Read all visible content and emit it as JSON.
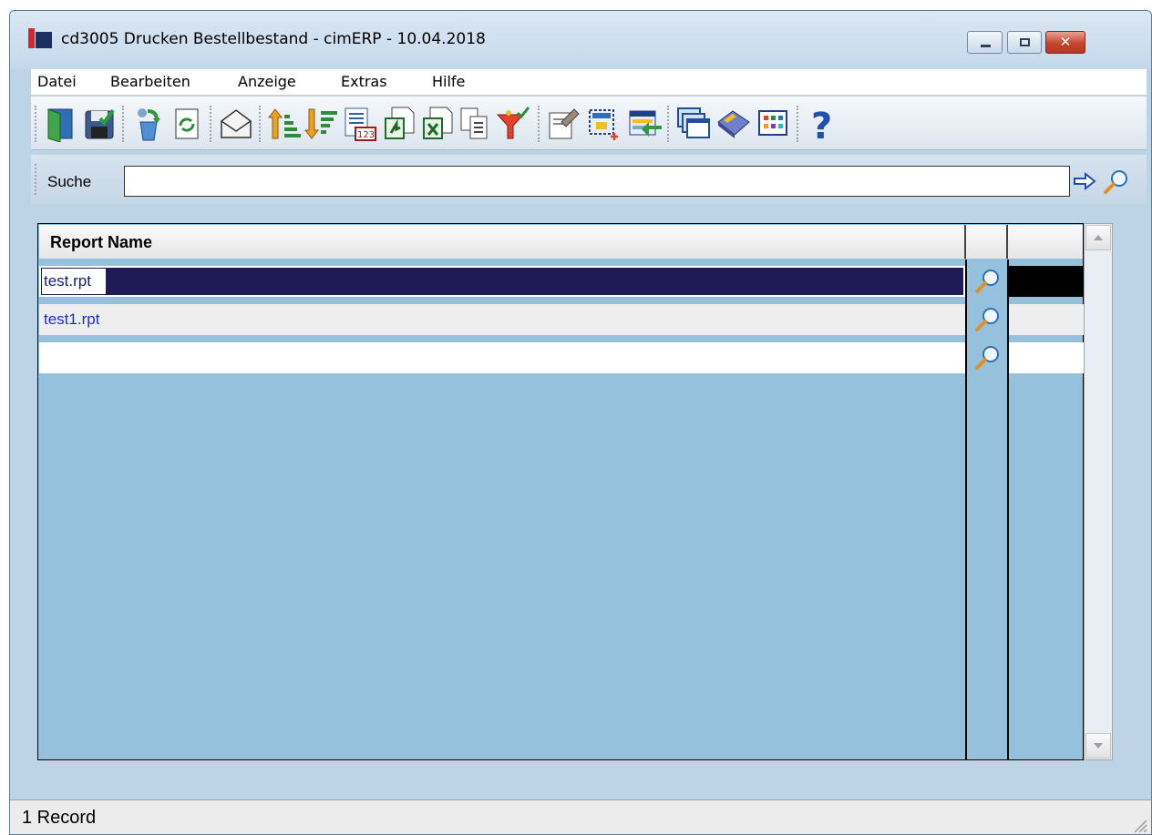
{
  "window": {
    "title": "cd3005 Drucken Bestellbestand - cimERP - 10.04.2018",
    "close_label": "✕"
  },
  "menu": {
    "items": [
      "Datei",
      "Bearbeiten",
      "Anzeige",
      "Extras",
      "Hilfe"
    ]
  },
  "toolbar": {
    "buttons": [
      "exit-icon",
      "save-icon",
      "transfer-icon",
      "refresh-icon",
      "email-icon",
      "sort-ascending-icon",
      "sort-descending-icon",
      "numbering-icon",
      "export-icon",
      "excel-export-icon",
      "copy-icon",
      "filter-icon",
      "edit-icon",
      "new-record-icon",
      "import-icon",
      "windows-icon",
      "book-icon",
      "grid-settings-icon",
      "help-icon"
    ]
  },
  "search": {
    "label": "Suche",
    "value": ""
  },
  "grid": {
    "columns": [
      "Report Name",
      "",
      ""
    ],
    "rows": [
      {
        "name": "test.rpt",
        "selected": true
      },
      {
        "name": "test1.rpt",
        "selected": false
      },
      {
        "name": "",
        "selected": false
      }
    ]
  },
  "status": {
    "text": "1 Record"
  },
  "colors": {
    "selected_row": "#1e1b56",
    "grid_background": "#96c1dd",
    "row_text": "#1a2fc8",
    "close_button": "#c4452c"
  }
}
